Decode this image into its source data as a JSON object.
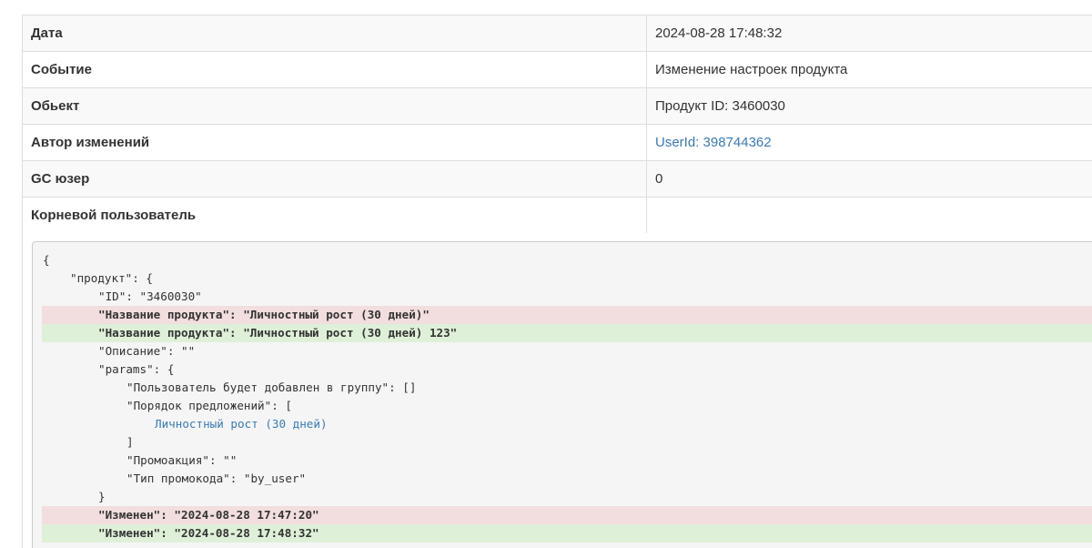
{
  "info": [
    {
      "label": "Дата",
      "value": "2024-08-28 17:48:32"
    },
    {
      "label": "Событие",
      "value": "Изменение настроек продукта"
    },
    {
      "label": "Обьект",
      "value": "Продукт ID: 3460030"
    },
    {
      "label": "Автор изменений",
      "value": "UserId: 398744362"
    },
    {
      "label": "GC юзер",
      "value": "0"
    },
    {
      "label": "Корневой пользователь",
      "value": ""
    }
  ],
  "diff": {
    "open_brace": "{",
    "product_open": "\"продукт\": {",
    "id_line": "\"ID\": \"3460030\"",
    "name_removed": "\"Название продукта\": \"Личностный рост (30 дней)\"",
    "name_added": "\"Название продукта\": \"Личностный рост (30 дней) 123\"",
    "description_line": "\"Описание\": \"\"",
    "params_open": "\"params\": {",
    "group_line": "\"Пользователь будет добавлен в группу\": []",
    "offers_open": "\"Порядок предложений\": [",
    "offer_item": "Личностный рост (30 дней)",
    "offers_close": "]",
    "promo_line": "\"Промоакция\": \"\"",
    "promo_type_line": "\"Тип промокода\": \"by_user\"",
    "params_close": "}",
    "changed_removed": "\"Изменен\": \"2024-08-28 17:47:20\"",
    "changed_added": "\"Изменен\": \"2024-08-28 17:48:32\""
  },
  "colors": {
    "link": "#3a7ab8",
    "removed_bg": "#f2dede",
    "added_bg": "#dff0d8",
    "code_bg": "#f5f5f5"
  }
}
